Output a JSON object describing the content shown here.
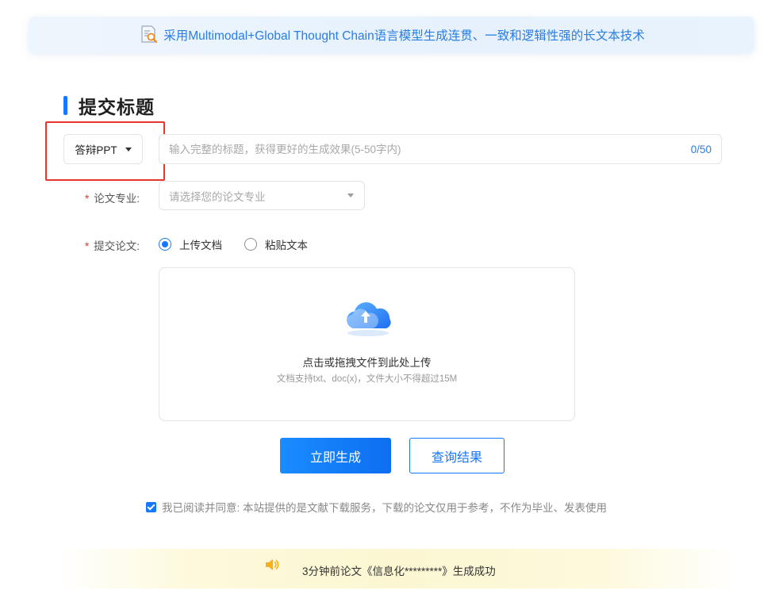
{
  "banner": {
    "text": "采用Multimodal+Global Thought Chain语言模型生成连贯、一致和逻辑性强的长文本技术",
    "icon": "document-search-icon"
  },
  "section": {
    "title": "提交标题"
  },
  "form": {
    "type_select": {
      "value": "答辩PPT",
      "icon": "caret-down-icon"
    },
    "title_input": {
      "placeholder": "输入完整的标题，获得更好的生成效果(5-50字内)",
      "value": "",
      "counter": "0/50"
    },
    "major": {
      "required_mark": "*",
      "label": "论文专业:",
      "placeholder": "请选择您的论文专业"
    },
    "submit_paper": {
      "required_mark": "*",
      "label": "提交论文:",
      "options": [
        {
          "label": "上传文档",
          "selected": true
        },
        {
          "label": "粘贴文本",
          "selected": false
        }
      ]
    },
    "upload": {
      "icon": "cloud-upload-icon",
      "main_text": "点击或拖拽文件到此处上传",
      "sub_text": "文档支持txt、doc(x)，文件大小不得超过15M"
    }
  },
  "actions": {
    "generate_label": "立即生成",
    "query_label": "查询结果"
  },
  "agreement": {
    "checked": true,
    "text": "我已阅读并同意: 本站提供的是文献下载服务，下载的论文仅用于参考，不作为毕业、发表使用"
  },
  "notice": {
    "icon": "speaker-icon",
    "text": "3分钟前论文《信息化*********》生成成功"
  },
  "colors": {
    "accent": "#1677ff",
    "highlight_border": "#e8352b",
    "banner_text": "#2a7de1"
  }
}
